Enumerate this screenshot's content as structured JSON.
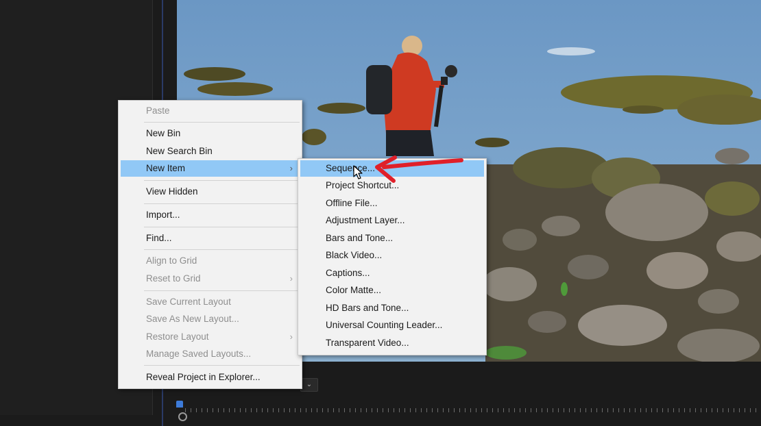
{
  "main_menu": {
    "paste": "Paste",
    "new_bin": "New Bin",
    "new_search_bin": "New Search Bin",
    "new_item": "New Item",
    "view_hidden": "View Hidden",
    "import": "Import...",
    "find": "Find...",
    "align_to_grid": "Align to Grid",
    "reset_to_grid": "Reset to Grid",
    "save_current_layout": "Save Current Layout",
    "save_as_new_layout": "Save As New Layout...",
    "restore_layout": "Restore Layout",
    "manage_saved_layouts": "Manage Saved Layouts...",
    "reveal_project": "Reveal Project in Explorer..."
  },
  "sub_menu": {
    "sequence": "Sequence...",
    "project_shortcut": "Project Shortcut...",
    "offline_file": "Offline File...",
    "adjustment_layer": "Adjustment Layer...",
    "bars_and_tone": "Bars and Tone...",
    "black_video": "Black Video...",
    "captions": "Captions...",
    "color_matte": "Color Matte...",
    "hd_bars_and_tone": "HD Bars and Tone...",
    "universal_counting_leader": "Universal Counting Leader...",
    "transparent_video": "Transparent Video..."
  },
  "icons": {
    "submenu_arrow": "›",
    "dropdown_chevron": "⌄"
  },
  "colors": {
    "menu_bg": "#f2f2f2",
    "highlight": "#91c8f6",
    "annotation_arrow": "#e0202a",
    "playhead": "#3d7bd9"
  }
}
